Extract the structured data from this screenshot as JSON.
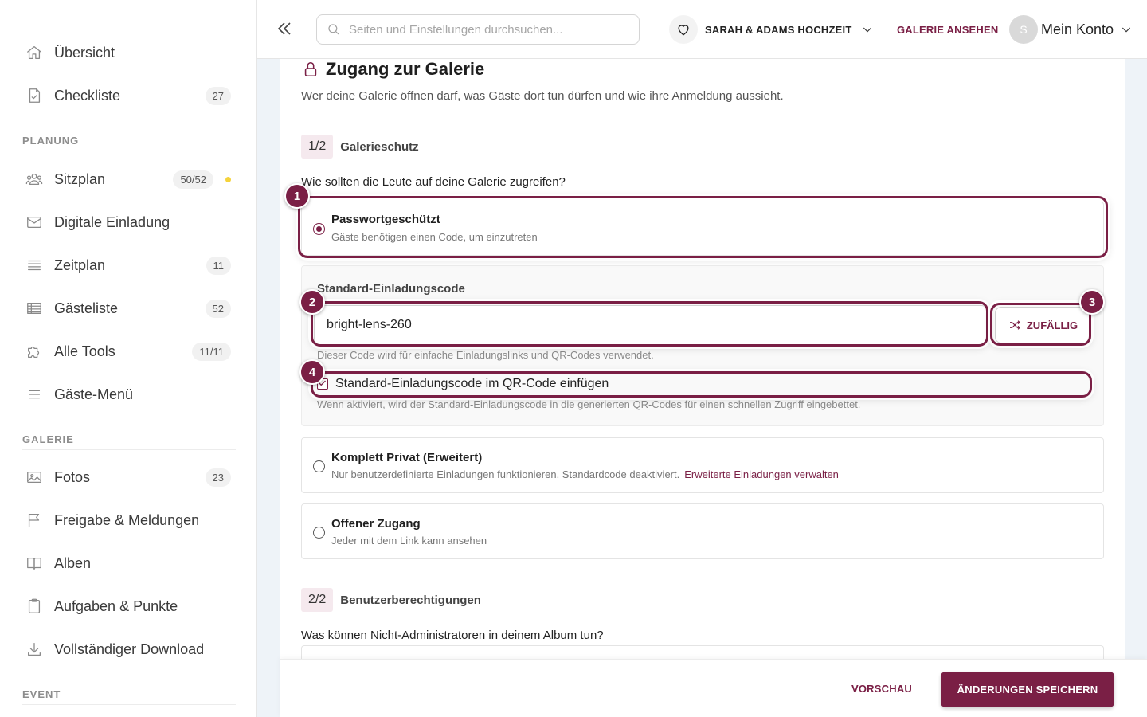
{
  "sidebar": {
    "items": [
      {
        "label": "Übersicht",
        "icon": "home-icon"
      },
      {
        "label": "Checkliste",
        "icon": "checklist-icon",
        "badge": "27"
      }
    ],
    "planning_title": "PLANUNG",
    "planning": [
      {
        "label": "Sitzplan",
        "icon": "people-icon",
        "badge": "50/52",
        "dot_color": "#f5d33b"
      },
      {
        "label": "Digitale Einladung",
        "icon": "envelope-icon"
      },
      {
        "label": "Zeitplan",
        "icon": "list-icon",
        "badge": "11"
      },
      {
        "label": "Gästeliste",
        "icon": "table-icon",
        "badge": "52"
      },
      {
        "label": "Alle Tools",
        "icon": "puzzle-icon",
        "badge": "11/11"
      },
      {
        "label": "Gäste-Menü",
        "icon": "menu-icon"
      }
    ],
    "gallery_title": "GALERIE",
    "gallery": [
      {
        "label": "Fotos",
        "icon": "image-icon",
        "badge": "23"
      },
      {
        "label": "Freigabe & Meldungen",
        "icon": "flag-icon"
      },
      {
        "label": "Alben",
        "icon": "book-icon"
      },
      {
        "label": "Aufgaben & Punkte",
        "icon": "clipboard-icon"
      },
      {
        "label": "Vollständiger Download",
        "icon": "download-icon"
      }
    ],
    "event_title": "EVENT"
  },
  "header": {
    "search_placeholder": "Seiten und Einstellungen durchsuchen...",
    "event_name": "SARAH & ADAMS HOCHZEIT",
    "view_gallery": "GALERIE ANSEHEN",
    "avatar_initial": "S",
    "account_label": "Mein Konto"
  },
  "main": {
    "title": "Zugang zur Galerie",
    "subtitle": "Wer deine Galerie öffnen darf, was Gäste dort tun dürfen und wie ihre Anmeldung aussieht.",
    "step1": {
      "num": "1/2",
      "label": "Galerieschutz"
    },
    "question1": "Wie sollten die Leute auf deine Galerie zugreifen?",
    "options": [
      {
        "title": "Passwortgeschützt",
        "desc": "Gäste benötigen einen Code, um einzutreten",
        "selected": true
      },
      {
        "title": "Komplett Privat (Erweitert)",
        "desc": "Nur benutzerdefinierte Einladungen funktionieren. Standardcode deaktiviert.",
        "link": "Erweiterte Einladungen verwalten",
        "selected": false
      },
      {
        "title": "Offener Zugang",
        "desc": "Jeder mit dem Link kann ansehen",
        "selected": false
      }
    ],
    "code": {
      "label": "Standard-Einladungscode",
      "value": "bright-lens-260",
      "random_label": "ZUFÄLLIG",
      "hint": "Dieser Code wird für einfache Einladungslinks und QR-Codes verwendet.",
      "checkbox_label": "Standard-Einladungscode im QR-Code einfügen",
      "checkbox_checked": true,
      "checkbox_hint": "Wenn aktiviert, wird der Standard-Einladungscode in die generierten QR-Codes für einen schnellen Zugriff eingebettet."
    },
    "step2": {
      "num": "2/2",
      "label": "Benutzerberechtigungen"
    },
    "question2": "Was können Nicht-Administratoren in deinem Album tun?"
  },
  "markers": [
    "1",
    "2",
    "3",
    "4"
  ],
  "footer": {
    "preview": "VORSCHAU",
    "save": "ÄNDERUNGEN SPEICHERN"
  },
  "colors": {
    "accent": "#7a1f45",
    "badge_dot": "#f5d33b"
  }
}
